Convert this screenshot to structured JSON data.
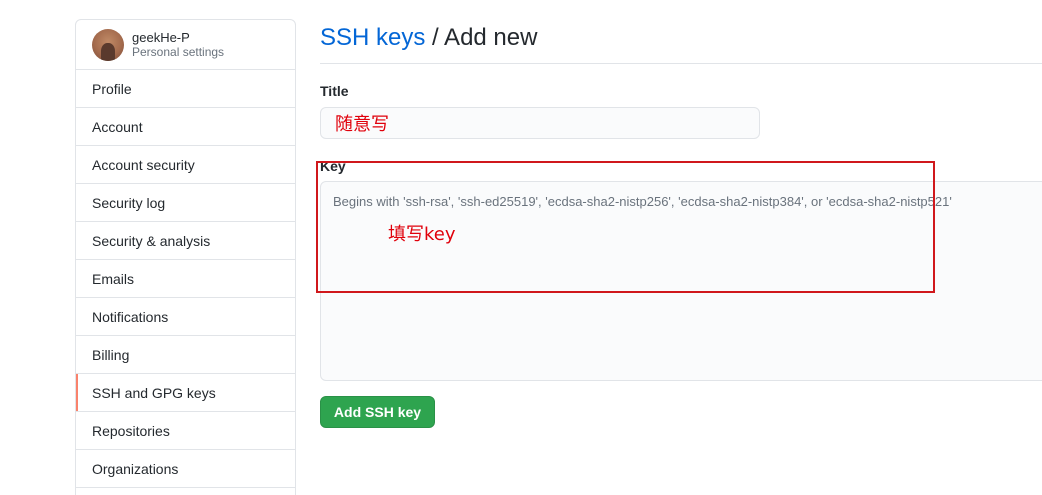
{
  "sidebar": {
    "username": "geekHe-P",
    "subtitle": "Personal settings",
    "items": [
      {
        "label": "Profile"
      },
      {
        "label": "Account"
      },
      {
        "label": "Account security"
      },
      {
        "label": "Security log"
      },
      {
        "label": "Security & analysis"
      },
      {
        "label": "Emails"
      },
      {
        "label": "Notifications"
      },
      {
        "label": "Billing"
      },
      {
        "label": "SSH and GPG keys",
        "selected": true
      },
      {
        "label": "Repositories"
      },
      {
        "label": "Organizations"
      }
    ]
  },
  "page": {
    "breadcrumb_link": "SSH keys",
    "breadcrumb_rest": " / Add new"
  },
  "form": {
    "title_label": "Title",
    "title_value": "随意写",
    "key_label": "Key",
    "key_placeholder": "Begins with 'ssh-rsa', 'ssh-ed25519', 'ecdsa-sha2-nistp256', 'ecdsa-sha2-nistp384', or 'ecdsa-sha2-nistp521'",
    "key_annotation": "填写key",
    "submit_label": "Add SSH key"
  },
  "colors": {
    "link": "#0366d6",
    "primary_button": "#2ea44f",
    "selected_indicator": "#f9826c",
    "annotation": "#e0000b"
  }
}
